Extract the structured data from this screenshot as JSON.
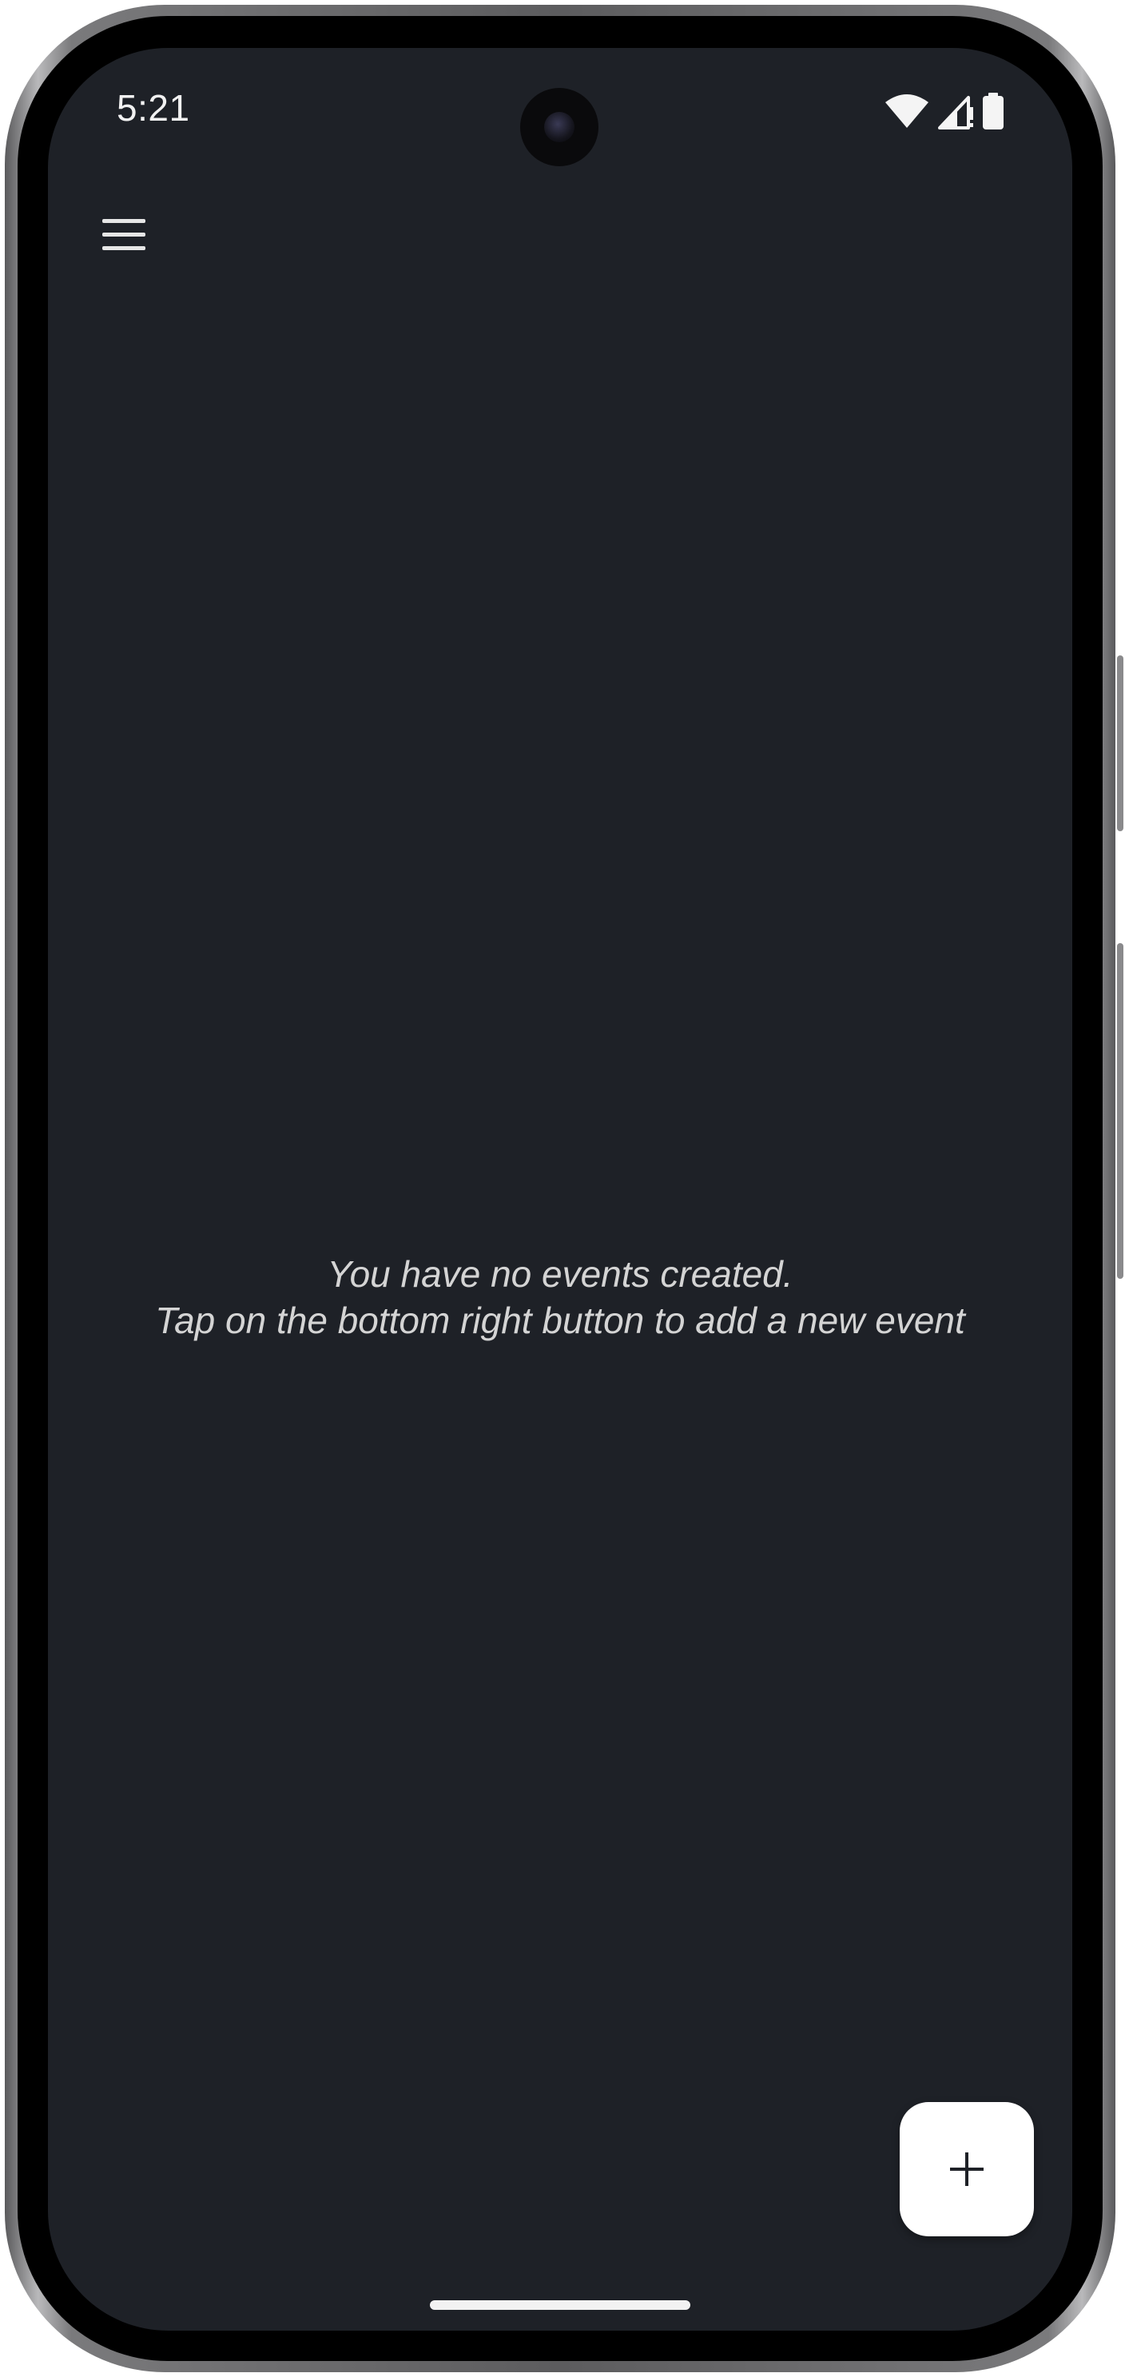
{
  "status_bar": {
    "time": "5:21",
    "icons": [
      "wifi-icon",
      "cellular-signal-icon",
      "battery-icon"
    ]
  },
  "app_bar": {
    "menu_icon": "hamburger-menu-icon"
  },
  "empty_state": {
    "line1": "You have no events created.",
    "line2": "Tap on the bottom right button to add a new event"
  },
  "fab": {
    "icon": "plus-icon"
  },
  "colors": {
    "background": "#1e2127",
    "text": "#d4d4d4",
    "fab_background": "#ffffff",
    "fab_icon": "#1e2127"
  }
}
